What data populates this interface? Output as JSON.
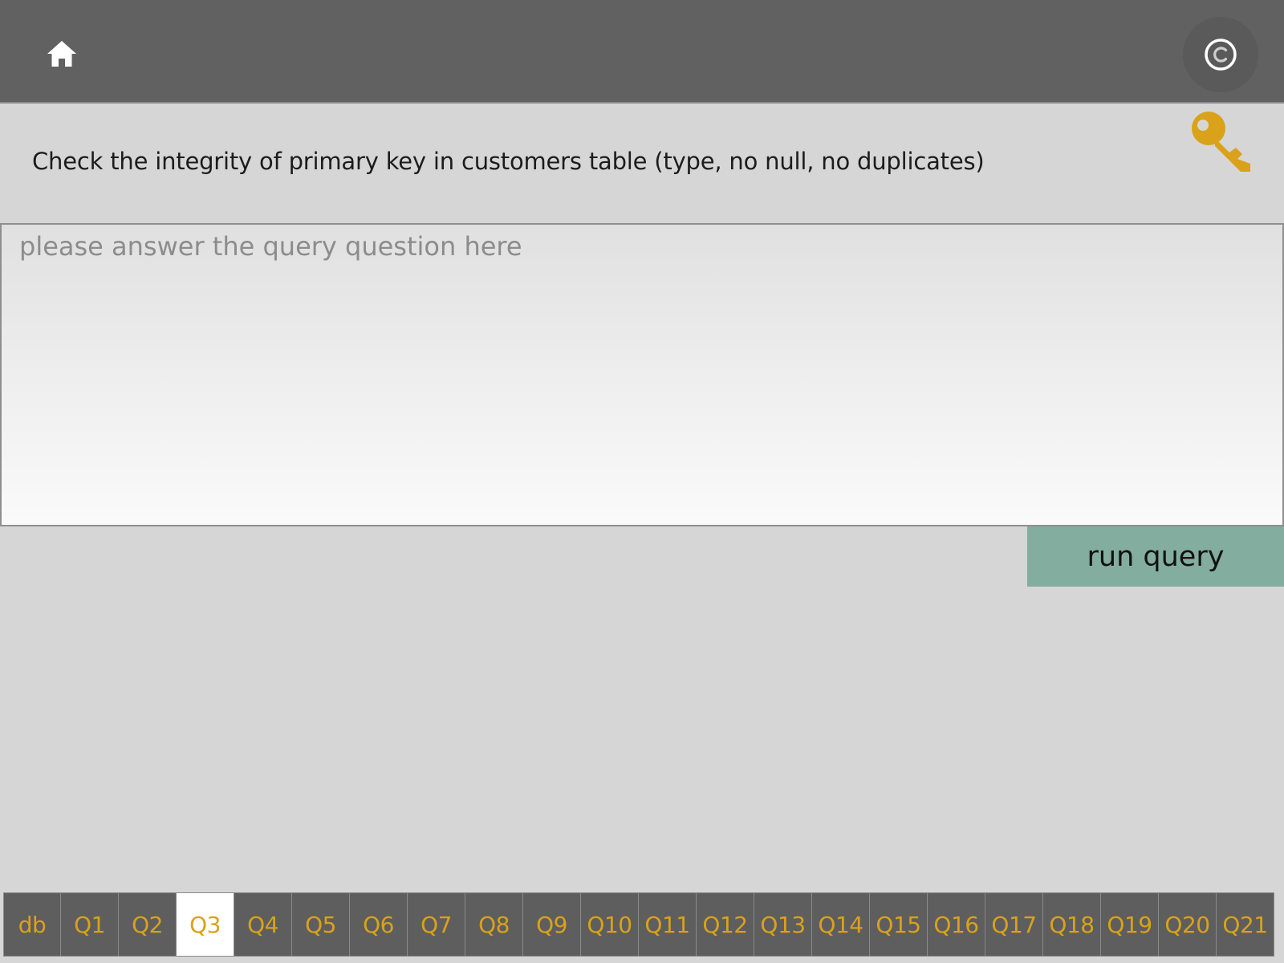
{
  "header": {
    "home_icon": "home-icon",
    "copyright_icon": "copyright-icon"
  },
  "key_icon": "key-icon",
  "colors": {
    "topbar": "#616161",
    "background": "#d6d6d6",
    "accent": "#d9a21a",
    "run_button": "#83ad9f",
    "tab_background": "#5e5e5e",
    "tab_active_background": "#ffffff"
  },
  "question": {
    "text": "Check the integrity of primary key in customers table (type, no null, no duplicates)"
  },
  "query": {
    "value": "",
    "placeholder": "please answer the query question here"
  },
  "run_button": {
    "label": "run query"
  },
  "tabs": {
    "active": "Q3",
    "items": [
      "db",
      "Q1",
      "Q2",
      "Q3",
      "Q4",
      "Q5",
      "Q6",
      "Q7",
      "Q8",
      "Q9",
      "Q10",
      "Q11",
      "Q12",
      "Q13",
      "Q14",
      "Q15",
      "Q16",
      "Q17",
      "Q18",
      "Q19",
      "Q20",
      "Q21"
    ]
  }
}
